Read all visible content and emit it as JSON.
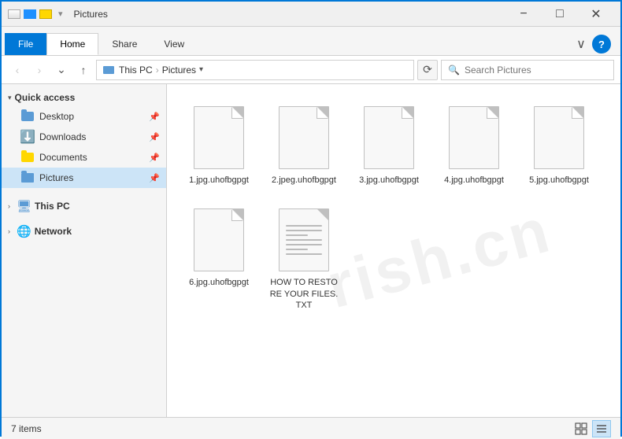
{
  "titleBar": {
    "title": "Pictures",
    "minimizeLabel": "−",
    "maximizeLabel": "□",
    "closeLabel": "✕"
  },
  "ribbon": {
    "tabs": [
      "File",
      "Home",
      "Share",
      "View"
    ],
    "activeTab": "Home",
    "expandLabel": "∨",
    "helpLabel": "?"
  },
  "addressBar": {
    "backLabel": "‹",
    "forwardLabel": "›",
    "upLabel": "↑",
    "dropdownLabel": "∨",
    "refreshLabel": "⟳",
    "paths": [
      "This PC",
      "Pictures"
    ],
    "searchPlaceholder": "Search Pictures"
  },
  "sidebar": {
    "sections": [
      {
        "id": "quick-access",
        "label": "Quick access",
        "items": [
          {
            "id": "desktop",
            "label": "Desktop",
            "icon": "folder",
            "pinned": true
          },
          {
            "id": "downloads",
            "label": "Downloads",
            "icon": "downloads",
            "pinned": true
          },
          {
            "id": "documents",
            "label": "Documents",
            "icon": "documents",
            "pinned": true
          },
          {
            "id": "pictures",
            "label": "Pictures",
            "icon": "pictures",
            "pinned": true,
            "active": true
          }
        ]
      },
      {
        "id": "this-pc",
        "label": "This PC",
        "items": []
      },
      {
        "id": "network",
        "label": "Network",
        "items": []
      }
    ]
  },
  "files": [
    {
      "id": "file1",
      "name": "1.jpg.uhofbgpgt",
      "type": "generic"
    },
    {
      "id": "file2",
      "name": "2.jpeg.uhofbgpgt",
      "type": "generic"
    },
    {
      "id": "file3",
      "name": "3.jpg.uhofbgpgt",
      "type": "generic"
    },
    {
      "id": "file4",
      "name": "4.jpg.uhofbgpgt",
      "type": "generic"
    },
    {
      "id": "file5",
      "name": "5.jpg.uhofbgpgt",
      "type": "generic"
    },
    {
      "id": "file6",
      "name": "6.jpg.uhofbgpgt",
      "type": "generic"
    },
    {
      "id": "file7",
      "name": "HOW TO RESTORE YOUR FILES.TXT",
      "type": "text"
    }
  ],
  "statusBar": {
    "itemCount": "7 items",
    "viewGridLabel": "⊞",
    "viewListLabel": "☰"
  },
  "watermark": "rish.cn"
}
